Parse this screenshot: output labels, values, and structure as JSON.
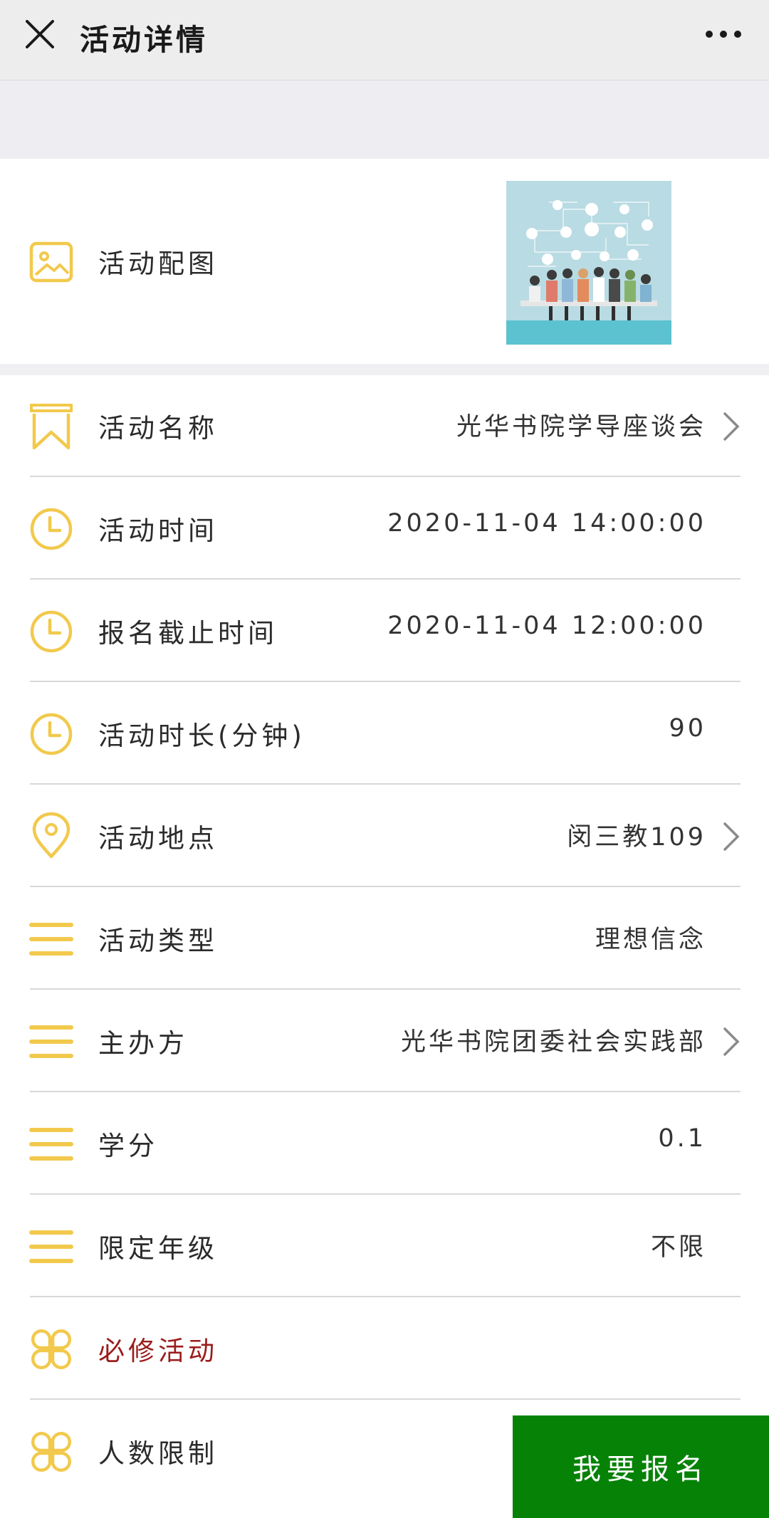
{
  "header": {
    "title": "活动详情",
    "close_icon": "close-icon",
    "more_icon": "more-dots-icon"
  },
  "nav": {
    "back_icon": "arrow-left-icon"
  },
  "image_row": {
    "label": "活动配图",
    "icon": "image-icon"
  },
  "details": [
    {
      "id": "name",
      "label": "活动名称",
      "value": "光华书院学导座谈会",
      "icon": "bookmark-icon",
      "chevron": true
    },
    {
      "id": "time",
      "label": "活动时间",
      "value": "2020-11-04  14:00:00",
      "icon": "clock-icon",
      "chevron": false
    },
    {
      "id": "deadline",
      "label": "报名截止时间",
      "value": "2020-11-04  12:00:00",
      "icon": "clock-icon",
      "chevron": false
    },
    {
      "id": "duration",
      "label": "活动时长(分钟)",
      "value": "90",
      "icon": "clock-icon",
      "chevron": false
    },
    {
      "id": "location",
      "label": "活动地点",
      "value": "闵三教109",
      "icon": "location-pin-icon",
      "chevron": true
    },
    {
      "id": "type",
      "label": "活动类型",
      "value": "理想信念",
      "icon": "menu-lines-icon",
      "chevron": false
    },
    {
      "id": "organizer",
      "label": "主办方",
      "value": "光华书院团委社会实践部",
      "icon": "menu-lines-icon",
      "chevron": true
    },
    {
      "id": "credit",
      "label": "学分",
      "value": "0.1",
      "icon": "menu-lines-icon",
      "chevron": false
    },
    {
      "id": "grade",
      "label": "限定年级",
      "value": "不限",
      "icon": "menu-lines-icon",
      "chevron": false
    },
    {
      "id": "required",
      "label": "必修活动",
      "value": "",
      "icon": "grid-circles-icon",
      "chevron": false
    },
    {
      "id": "limit",
      "label": "人数限制",
      "value": "",
      "icon": "grid-circles-icon",
      "chevron": false
    }
  ],
  "signup_button": "我要报名",
  "colors": {
    "accent_icon": "#f2c94c",
    "signup_bg": "#068206",
    "back_arrow": "#1f5aa6",
    "required_text": "#9b1c1c"
  }
}
